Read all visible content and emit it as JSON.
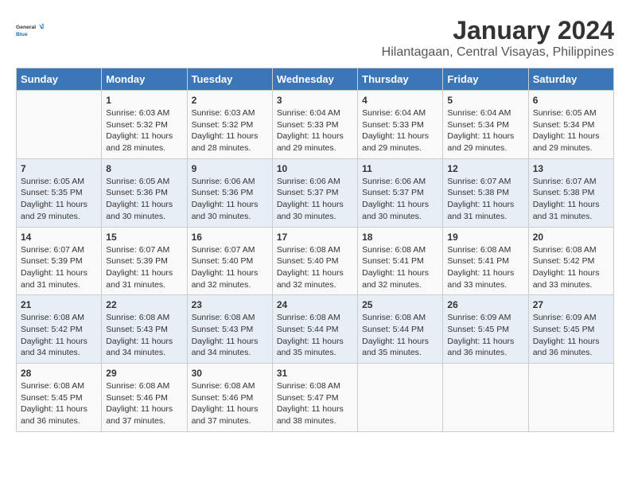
{
  "logo": {
    "general": "General",
    "blue": "Blue"
  },
  "title": "January 2024",
  "subtitle": "Hilantagaan, Central Visayas, Philippines",
  "headers": [
    "Sunday",
    "Monday",
    "Tuesday",
    "Wednesday",
    "Thursday",
    "Friday",
    "Saturday"
  ],
  "weeks": [
    [
      {
        "day": "",
        "lines": []
      },
      {
        "day": "1",
        "lines": [
          "Sunrise: 6:03 AM",
          "Sunset: 5:32 PM",
          "Daylight: 11 hours",
          "and 28 minutes."
        ]
      },
      {
        "day": "2",
        "lines": [
          "Sunrise: 6:03 AM",
          "Sunset: 5:32 PM",
          "Daylight: 11 hours",
          "and 28 minutes."
        ]
      },
      {
        "day": "3",
        "lines": [
          "Sunrise: 6:04 AM",
          "Sunset: 5:33 PM",
          "Daylight: 11 hours",
          "and 29 minutes."
        ]
      },
      {
        "day": "4",
        "lines": [
          "Sunrise: 6:04 AM",
          "Sunset: 5:33 PM",
          "Daylight: 11 hours",
          "and 29 minutes."
        ]
      },
      {
        "day": "5",
        "lines": [
          "Sunrise: 6:04 AM",
          "Sunset: 5:34 PM",
          "Daylight: 11 hours",
          "and 29 minutes."
        ]
      },
      {
        "day": "6",
        "lines": [
          "Sunrise: 6:05 AM",
          "Sunset: 5:34 PM",
          "Daylight: 11 hours",
          "and 29 minutes."
        ]
      }
    ],
    [
      {
        "day": "7",
        "lines": [
          "Sunrise: 6:05 AM",
          "Sunset: 5:35 PM",
          "Daylight: 11 hours",
          "and 29 minutes."
        ]
      },
      {
        "day": "8",
        "lines": [
          "Sunrise: 6:05 AM",
          "Sunset: 5:36 PM",
          "Daylight: 11 hours",
          "and 30 minutes."
        ]
      },
      {
        "day": "9",
        "lines": [
          "Sunrise: 6:06 AM",
          "Sunset: 5:36 PM",
          "Daylight: 11 hours",
          "and 30 minutes."
        ]
      },
      {
        "day": "10",
        "lines": [
          "Sunrise: 6:06 AM",
          "Sunset: 5:37 PM",
          "Daylight: 11 hours",
          "and 30 minutes."
        ]
      },
      {
        "day": "11",
        "lines": [
          "Sunrise: 6:06 AM",
          "Sunset: 5:37 PM",
          "Daylight: 11 hours",
          "and 30 minutes."
        ]
      },
      {
        "day": "12",
        "lines": [
          "Sunrise: 6:07 AM",
          "Sunset: 5:38 PM",
          "Daylight: 11 hours",
          "and 31 minutes."
        ]
      },
      {
        "day": "13",
        "lines": [
          "Sunrise: 6:07 AM",
          "Sunset: 5:38 PM",
          "Daylight: 11 hours",
          "and 31 minutes."
        ]
      }
    ],
    [
      {
        "day": "14",
        "lines": [
          "Sunrise: 6:07 AM",
          "Sunset: 5:39 PM",
          "Daylight: 11 hours",
          "and 31 minutes."
        ]
      },
      {
        "day": "15",
        "lines": [
          "Sunrise: 6:07 AM",
          "Sunset: 5:39 PM",
          "Daylight: 11 hours",
          "and 31 minutes."
        ]
      },
      {
        "day": "16",
        "lines": [
          "Sunrise: 6:07 AM",
          "Sunset: 5:40 PM",
          "Daylight: 11 hours",
          "and 32 minutes."
        ]
      },
      {
        "day": "17",
        "lines": [
          "Sunrise: 6:08 AM",
          "Sunset: 5:40 PM",
          "Daylight: 11 hours",
          "and 32 minutes."
        ]
      },
      {
        "day": "18",
        "lines": [
          "Sunrise: 6:08 AM",
          "Sunset: 5:41 PM",
          "Daylight: 11 hours",
          "and 32 minutes."
        ]
      },
      {
        "day": "19",
        "lines": [
          "Sunrise: 6:08 AM",
          "Sunset: 5:41 PM",
          "Daylight: 11 hours",
          "and 33 minutes."
        ]
      },
      {
        "day": "20",
        "lines": [
          "Sunrise: 6:08 AM",
          "Sunset: 5:42 PM",
          "Daylight: 11 hours",
          "and 33 minutes."
        ]
      }
    ],
    [
      {
        "day": "21",
        "lines": [
          "Sunrise: 6:08 AM",
          "Sunset: 5:42 PM",
          "Daylight: 11 hours",
          "and 34 minutes."
        ]
      },
      {
        "day": "22",
        "lines": [
          "Sunrise: 6:08 AM",
          "Sunset: 5:43 PM",
          "Daylight: 11 hours",
          "and 34 minutes."
        ]
      },
      {
        "day": "23",
        "lines": [
          "Sunrise: 6:08 AM",
          "Sunset: 5:43 PM",
          "Daylight: 11 hours",
          "and 34 minutes."
        ]
      },
      {
        "day": "24",
        "lines": [
          "Sunrise: 6:08 AM",
          "Sunset: 5:44 PM",
          "Daylight: 11 hours",
          "and 35 minutes."
        ]
      },
      {
        "day": "25",
        "lines": [
          "Sunrise: 6:08 AM",
          "Sunset: 5:44 PM",
          "Daylight: 11 hours",
          "and 35 minutes."
        ]
      },
      {
        "day": "26",
        "lines": [
          "Sunrise: 6:09 AM",
          "Sunset: 5:45 PM",
          "Daylight: 11 hours",
          "and 36 minutes."
        ]
      },
      {
        "day": "27",
        "lines": [
          "Sunrise: 6:09 AM",
          "Sunset: 5:45 PM",
          "Daylight: 11 hours",
          "and 36 minutes."
        ]
      }
    ],
    [
      {
        "day": "28",
        "lines": [
          "Sunrise: 6:08 AM",
          "Sunset: 5:45 PM",
          "Daylight: 11 hours",
          "and 36 minutes."
        ]
      },
      {
        "day": "29",
        "lines": [
          "Sunrise: 6:08 AM",
          "Sunset: 5:46 PM",
          "Daylight: 11 hours",
          "and 37 minutes."
        ]
      },
      {
        "day": "30",
        "lines": [
          "Sunrise: 6:08 AM",
          "Sunset: 5:46 PM",
          "Daylight: 11 hours",
          "and 37 minutes."
        ]
      },
      {
        "day": "31",
        "lines": [
          "Sunrise: 6:08 AM",
          "Sunset: 5:47 PM",
          "Daylight: 11 hours",
          "and 38 minutes."
        ]
      },
      {
        "day": "",
        "lines": []
      },
      {
        "day": "",
        "lines": []
      },
      {
        "day": "",
        "lines": []
      }
    ]
  ]
}
